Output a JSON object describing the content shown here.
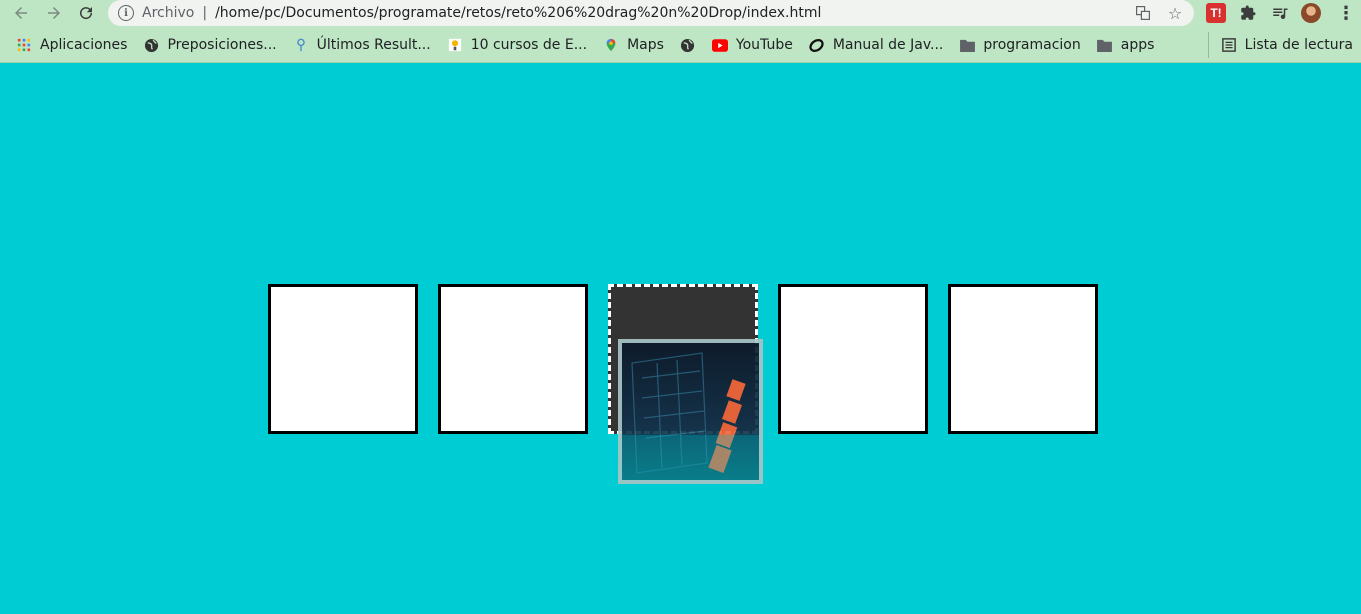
{
  "browser": {
    "address": {
      "scheme_label": "Archivo",
      "separator": "|",
      "url": "/home/pc/Documentos/programate/retos/reto%206%20drag%20n%20Drop/index.html"
    },
    "extensions": {
      "tt_label": "T!"
    }
  },
  "bookmarks": {
    "items": [
      {
        "label": "Aplicaciones",
        "icon": "apps-grid-icon"
      },
      {
        "label": "Preposiciones...",
        "icon": "globe-icon"
      },
      {
        "label": "Últimos Result...",
        "icon": "pin-icon"
      },
      {
        "label": "10 cursos de E...",
        "icon": "bulb-icon"
      },
      {
        "label": "Maps",
        "icon": "maps-pin-icon"
      },
      {
        "label": "",
        "icon": "globe-icon"
      },
      {
        "label": "YouTube",
        "icon": "youtube-icon"
      },
      {
        "label": "Manual de Jav...",
        "icon": "swirl-icon"
      },
      {
        "label": "programacion",
        "icon": "folder-icon"
      },
      {
        "label": "apps",
        "icon": "folder-icon"
      }
    ],
    "reading_list": "Lista de lectura"
  },
  "colors": {
    "page_background": "#00ccd3",
    "chrome_background": "#bfe6c4",
    "box_empty": "#ffffff",
    "box_dragging": "#333333"
  },
  "dropzones": {
    "count": 5,
    "dragging_index": 2
  }
}
